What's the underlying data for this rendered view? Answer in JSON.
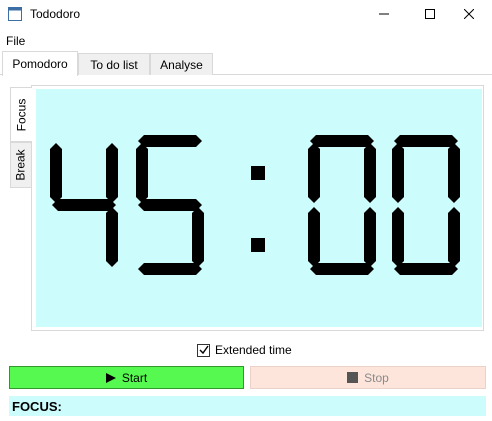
{
  "window": {
    "title": "Tododoro",
    "controls": {
      "minimize_icon": "minimize-icon",
      "maximize_icon": "maximize-icon",
      "close_icon": "close-icon"
    }
  },
  "menubar": {
    "file": "File"
  },
  "tabs": [
    {
      "label": "Pomodoro",
      "active": true
    },
    {
      "label": "To do list",
      "active": false
    },
    {
      "label": "Analyse",
      "active": false
    }
  ],
  "side_tabs": [
    {
      "label": "Focus",
      "active": true
    },
    {
      "label": "Break",
      "active": false
    }
  ],
  "timer": {
    "display": "45:00",
    "background_color": "#ccfcfc",
    "digit_color": "#000000"
  },
  "extended_time": {
    "label": "Extended time",
    "checked": true
  },
  "buttons": {
    "start": {
      "label": "Start",
      "icon": "play-icon",
      "color": "#55f94f"
    },
    "stop": {
      "label": "Stop",
      "icon": "stop-icon",
      "color": "#fde5dc",
      "enabled": false
    }
  },
  "status": {
    "text": "FOCUS:",
    "background_color": "#ccfcfc"
  }
}
